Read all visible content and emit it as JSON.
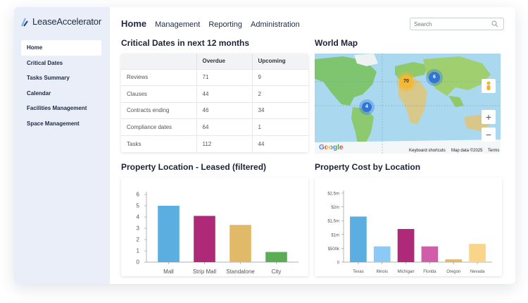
{
  "app": {
    "logo_text": "LeaseAccelerator"
  },
  "sidebar": {
    "items": [
      {
        "label": "Home"
      },
      {
        "label": "Critical Dates"
      },
      {
        "label": "Tasks Summary"
      },
      {
        "label": "Calendar"
      },
      {
        "label": "Facilities Management"
      },
      {
        "label": "Space Management"
      }
    ]
  },
  "topnav": {
    "items": [
      "Home",
      "Management",
      "Reporting",
      "Administration"
    ]
  },
  "search": {
    "placeholder": "Search"
  },
  "critical": {
    "title": "Critical Dates in next 12 months",
    "headers": [
      "",
      "Overdue",
      "Upcoming"
    ],
    "rows": [
      [
        "Reviews",
        "71",
        "9"
      ],
      [
        "Clauses",
        "44",
        "2"
      ],
      [
        "Contracts ending",
        "46",
        "34"
      ],
      [
        "Compliance dates",
        "64",
        "1"
      ],
      [
        "Tasks",
        "112",
        "44"
      ]
    ]
  },
  "map": {
    "title": "World Map",
    "clusters": [
      "70",
      "6",
      "4"
    ],
    "google": "Google",
    "shortcuts": "Keyboard shortcuts",
    "mapdata": "Map data ©2025",
    "terms": "Terms",
    "zoom_in": "+",
    "zoom_out": "−"
  },
  "chart_data": [
    {
      "type": "bar",
      "title": "Property Location - Leased (filtered)",
      "categories": [
        "Mall",
        "Strip Mall",
        "Standalone",
        "City"
      ],
      "values": [
        5,
        4.1,
        3.3,
        0.9
      ],
      "colors": [
        "#5aaee0",
        "#ae2a78",
        "#e0ba68",
        "#5aad55"
      ],
      "ylim": [
        0,
        6
      ],
      "yticks": [
        "0",
        "1",
        "2",
        "3",
        "4",
        "5",
        "6"
      ]
    },
    {
      "type": "bar",
      "title": "Property Cost by Location",
      "categories": [
        "Texas",
        "Illinois",
        "Michigan",
        "Florida",
        "Oregon",
        "Nevada"
      ],
      "values": [
        1650000,
        570000,
        1200000,
        570000,
        100000,
        660000
      ],
      "colors": [
        "#5aaee0",
        "#8ccaf5",
        "#ae2a78",
        "#cf5da8",
        "#e0ba68",
        "#f8d589"
      ],
      "ylim": [
        0,
        2500000
      ],
      "yticks": [
        "0",
        "$500k",
        "$1m",
        "$1,5m",
        "$2m",
        "$2,5m"
      ]
    }
  ]
}
